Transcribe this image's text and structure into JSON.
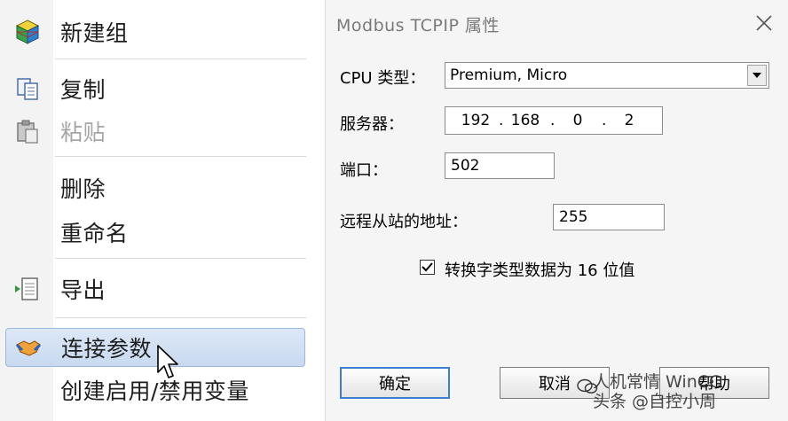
{
  "context_menu": {
    "items": [
      {
        "label": "新建组",
        "icon": "new-group-cube-icon",
        "disabled": false
      },
      {
        "label": "复制",
        "icon": "copy-icon",
        "disabled": false
      },
      {
        "label": "粘贴",
        "icon": "paste-icon",
        "disabled": true
      },
      {
        "label": "删除",
        "icon": "",
        "disabled": false
      },
      {
        "label": "重命名",
        "icon": "",
        "disabled": false
      },
      {
        "label": "导出",
        "icon": "export-icon",
        "disabled": false
      },
      {
        "label": "连接参数",
        "icon": "handshake-icon",
        "disabled": false,
        "selected": true
      },
      {
        "label": "创建启用/禁用变量",
        "icon": "",
        "disabled": false
      }
    ]
  },
  "dialog": {
    "title": "Modbus TCPIP 属性",
    "cpu_type": {
      "label": "CPU 类型：",
      "value": "Premium, Micro"
    },
    "server": {
      "label": "服务器：",
      "ip": [
        "192",
        "168",
        "0",
        "2"
      ]
    },
    "port": {
      "label": "端口：",
      "value": "502"
    },
    "remote_address": {
      "label": "远程从站的地址：",
      "value": "255"
    },
    "convert_checkbox": {
      "label": "转换字类型数据为 16 位值",
      "checked": true
    },
    "buttons": {
      "ok": "确定",
      "cancel": "取消",
      "help": "帮助"
    }
  },
  "watermark": {
    "line1": "人机常情 WinCC",
    "line2": "头条 @自控小周"
  },
  "colors": {
    "selection_bg": "#c8d9f0",
    "selection_border": "#9fb7df",
    "primary_button_border": "#3b7fd1"
  }
}
